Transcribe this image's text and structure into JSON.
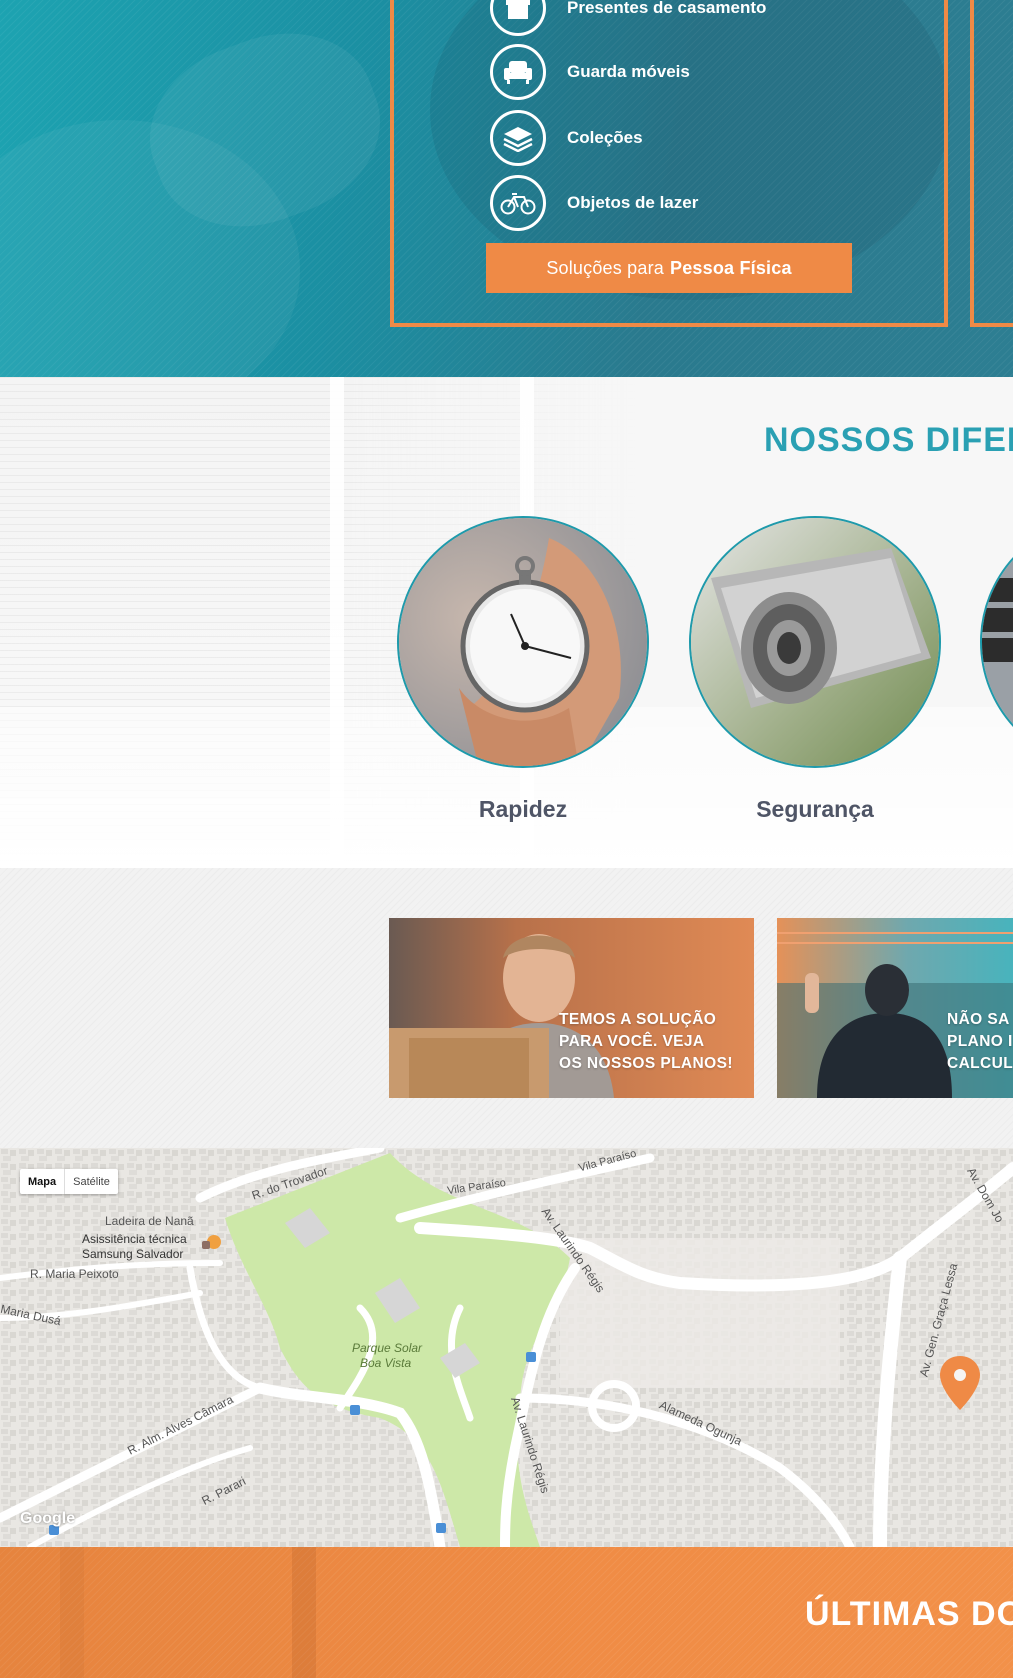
{
  "hero": {
    "features": [
      {
        "label": "Presentes de casamento",
        "icon": "gift-box-icon"
      },
      {
        "label": "Guarda móveis",
        "icon": "armchair-icon"
      },
      {
        "label": "Coleções",
        "icon": "stacked-layers-icon"
      },
      {
        "label": "Objetos de lazer",
        "icon": "bicycle-icon"
      }
    ],
    "cta_prefix": "Soluções para",
    "cta_strong": "Pessoa Física"
  },
  "differentials": {
    "title_light": "NOSSOS",
    "title_bold": "DIFER",
    "cards": [
      {
        "label": "Rapidez",
        "image": "stopwatch-photo"
      },
      {
        "label": "Segurança",
        "image": "security-camera-photo"
      },
      {
        "label": "",
        "image": "keyboard-photo"
      }
    ]
  },
  "promos": [
    {
      "text": "TEMOS A SOLUÇÃO\nPARA VOCÊ. VEJA\nOS NOSSOS PLANOS!"
    },
    {
      "text": "NÃO SA\nPLANO I\nCALCUL"
    }
  ],
  "map": {
    "map_button": "Mapa",
    "satellite_button": "Satélite",
    "labels": {
      "r_do_trovador": "R. do Trovador",
      "vila_paraiso_1": "Vila Paraíso",
      "vila_paraiso_2": "Vila Paraíso",
      "ladeira": "Ladeira de Nanã",
      "assist_1": "Asissitência técnica",
      "assist_2": "Samsung Salvador",
      "maria_peixoto": "R. Maria Peixoto",
      "maria_dusa": "Maria Dusá",
      "av_laurindo_1": "Av. Laurindo Régis",
      "av_laurindo_2": "Av. Laurindo Régis",
      "parque_1": "Parque Solar",
      "parque_2": "Boa Vista",
      "alves_camara": "R. Alm. Alves Câmara",
      "parari": "R. Parari",
      "alameda": "Alameda Ogunja",
      "graca_lessa": "Av. Gen. Graça Lessa",
      "dom_jo": "Av. Dom Jo"
    },
    "google": "Google"
  },
  "news": {
    "title": "ÚLTIMAS DO"
  },
  "colors": {
    "teal": "#1da3b1",
    "orange": "#ef8a46",
    "text_gray": "#4f5566"
  }
}
